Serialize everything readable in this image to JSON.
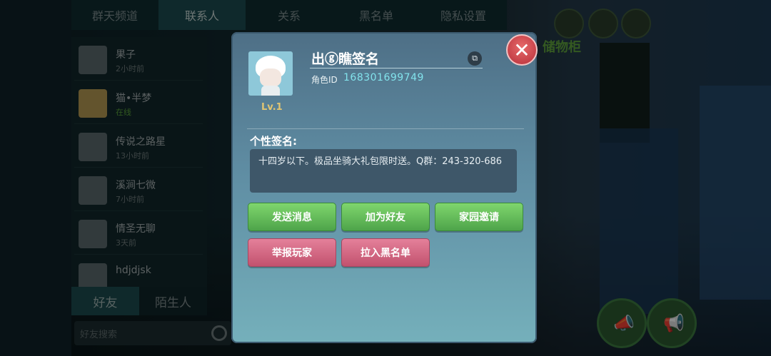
{
  "top_tabs": [
    "群天频道",
    "联系人",
    "关系",
    "黑名单",
    "隐私设置"
  ],
  "contacts": [
    {
      "name": "果子",
      "status": "2小时前",
      "online": false
    },
    {
      "name": "猫•半梦",
      "status": "在线",
      "online": true
    },
    {
      "name": "传说之路星",
      "status": "13小时前",
      "online": false
    },
    {
      "name": "溪涧七微",
      "status": "7小时前",
      "online": false
    },
    {
      "name": "情圣无聊",
      "status": "3天前",
      "online": false
    },
    {
      "name": "hdjdjsk",
      "status": "",
      "online": false
    }
  ],
  "bottom_tabs": {
    "friends": "好友",
    "strangers": "陌生人"
  },
  "search": {
    "placeholder": "好友搜索"
  },
  "hud": {
    "storage_label": "储物柜"
  },
  "profile": {
    "name": "出ⓖ瞧签名",
    "level": "Lv.1",
    "id_label": "角色ID",
    "id_value": "168301699749",
    "signature_title": "个性签名:",
    "signature_text": "十四岁以下。极品坐骑大礼包限时送。Q群：243-320-686"
  },
  "buttons": {
    "send_message": "发送消息",
    "add_friend": "加为好友",
    "home_invite": "家园邀请",
    "report": "举报玩家",
    "blacklist": "拉入黑名单"
  },
  "colors": {
    "green_button": "#5dba52",
    "pink_button": "#d0647f",
    "id_color": "#82e3ec",
    "level_color": "#e1c572"
  }
}
